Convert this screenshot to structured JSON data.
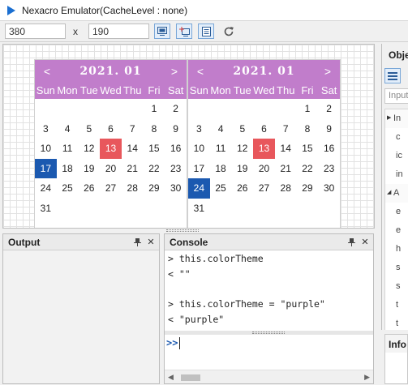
{
  "window": {
    "title": "Nexacro Emulator(CacheLevel : none)"
  },
  "toolbar": {
    "width_value": "380",
    "separator": "x",
    "height_value": "190"
  },
  "calendars": [
    {
      "year_month": "2021. 01",
      "prev": "<",
      "next": ">",
      "weekdays": [
        "Sun",
        "Mon",
        "Tue",
        "Wed",
        "Thu",
        "Fri",
        "Sat"
      ],
      "days": [
        "",
        "",
        "",
        "",
        "",
        "1",
        "2",
        "3",
        "4",
        "5",
        "6",
        "7",
        "8",
        "9",
        "10",
        "11",
        "12",
        "13",
        "14",
        "15",
        "16",
        "17",
        "18",
        "19",
        "20",
        "21",
        "22",
        "23",
        "24",
        "25",
        "26",
        "27",
        "28",
        "29",
        "30",
        "31"
      ],
      "selected_day": "17",
      "highlighted_day": "13"
    },
    {
      "year_month": "2021. 01",
      "prev": "<",
      "next": ">",
      "weekdays": [
        "Sun",
        "Mon",
        "Tue",
        "Wed",
        "Thu",
        "Fri",
        "Sat"
      ],
      "days": [
        "",
        "",
        "",
        "",
        "",
        "1",
        "2",
        "3",
        "4",
        "5",
        "6",
        "7",
        "8",
        "9",
        "10",
        "11",
        "12",
        "13",
        "14",
        "15",
        "16",
        "17",
        "18",
        "19",
        "20",
        "21",
        "22",
        "23",
        "24",
        "25",
        "26",
        "27",
        "28",
        "29",
        "30",
        "31"
      ],
      "selected_day": "24",
      "highlighted_day": "13"
    }
  ],
  "output_panel": {
    "title": "Output"
  },
  "console_panel": {
    "title": "Console",
    "lines": [
      "> this.colorTheme",
      "< \"\"",
      "",
      "> this.colorTheme = \"purple\"",
      "< \"purple\""
    ],
    "prompt": ">>"
  },
  "objects_panel": {
    "title": "Obje",
    "search_placeholder": "Input",
    "rows": [
      {
        "label": "In",
        "group": true,
        "twisty": "▶"
      },
      {
        "label": "c",
        "group": false
      },
      {
        "label": "ic",
        "group": false
      },
      {
        "label": "in",
        "group": false
      },
      {
        "label": "A",
        "group": true,
        "twisty": "◢"
      },
      {
        "label": "e",
        "group": false
      },
      {
        "label": "e",
        "group": false
      },
      {
        "label": "h",
        "group": false
      },
      {
        "label": "s",
        "group": false
      },
      {
        "label": "s",
        "group": false
      },
      {
        "label": "t",
        "group": false
      },
      {
        "label": "t",
        "group": false
      }
    ]
  },
  "info_panel": {
    "title": "Info"
  },
  "colors": {
    "calendar_header": "#c17dcb",
    "selected_day": "#1b59b0",
    "highlighted_day": "#e8575c",
    "accent_blue": "#1b59b0"
  }
}
